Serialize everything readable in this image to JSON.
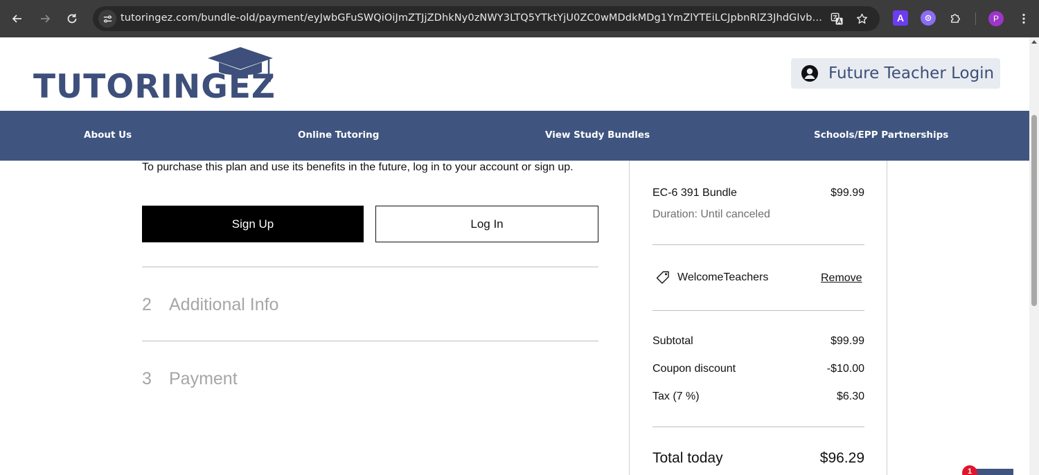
{
  "browser": {
    "url": "tutoringez.com/bundle-old/payment/eyJwbGFuSWQiOiJmZTJjZDhkNy0zNWY3LTQ5YTktYjU0ZC0wMDdkMDg1YmZlYTEiLCJpbnRlZ3JhdGlvbkRhdGEi...",
    "profile_initial": "P",
    "ext_a_label": "A"
  },
  "header": {
    "logo_text": "TUTORINGEZ",
    "login_label": "Future Teacher Login"
  },
  "nav": {
    "items": [
      {
        "label": "About Us"
      },
      {
        "label": "Online Tutoring"
      },
      {
        "label": "View Study Bundles"
      },
      {
        "label": "Schools/EPP Partnerships"
      }
    ]
  },
  "checkout": {
    "intro_text": "To purchase this plan and use its benefits in the future, log in to your account or sign up.",
    "signup_label": "Sign Up",
    "login_label": "Log In",
    "steps": [
      {
        "number": "2",
        "label": "Additional Info"
      },
      {
        "number": "3",
        "label": "Payment"
      }
    ]
  },
  "summary": {
    "item_name": "EC-6 391 Bundle",
    "item_price": "$99.99",
    "duration": "Duration: Until canceled",
    "coupon_code": "WelcomeTeachers",
    "remove_label": "Remove",
    "subtotal_label": "Subtotal",
    "subtotal_value": "$99.99",
    "discount_label": "Coupon discount",
    "discount_value": "-$10.00",
    "tax_label": "Tax (7 %)",
    "tax_value": "$6.30",
    "total_label": "Total today",
    "total_value": "$96.29"
  },
  "chat": {
    "badge_count": "1"
  },
  "colors": {
    "brand_navy": "#3d4f7a",
    "nav_bg": "#3f5580",
    "chrome_bg": "#3c3c3c"
  }
}
